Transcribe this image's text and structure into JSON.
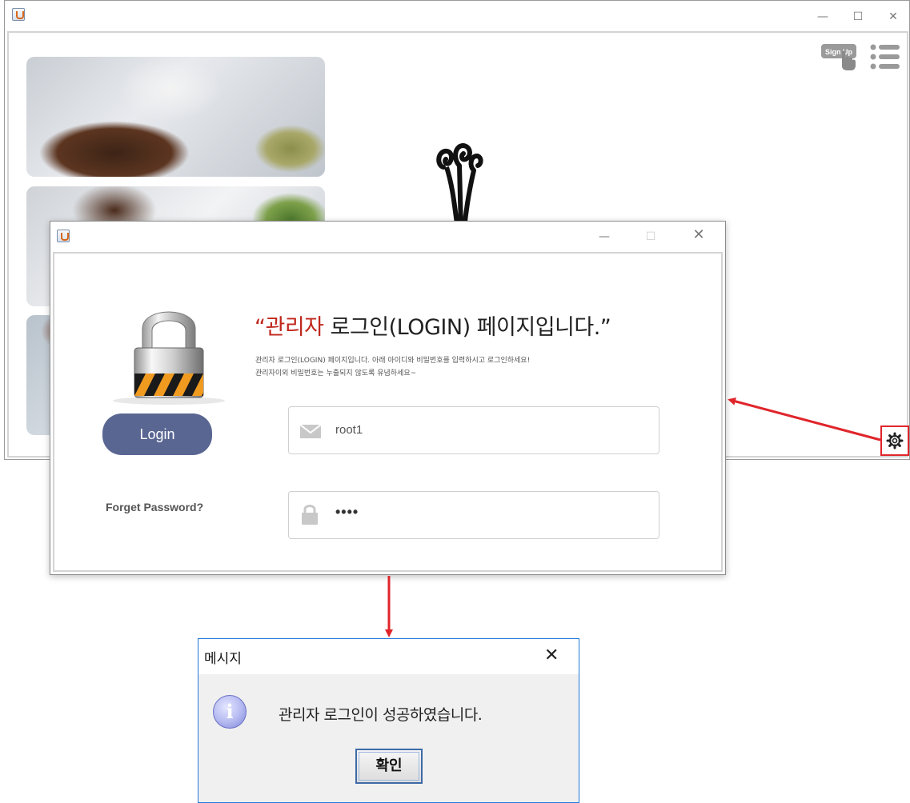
{
  "main_window": {
    "controls": {
      "minimize": "—",
      "maximize": "☐",
      "close": "✕"
    },
    "header_icons": {
      "signup": "Sign Up",
      "signup_icon": "signup-hand-icon",
      "menu_icon": "hamburger-menu-icon"
    },
    "settings_icon": "gear-icon"
  },
  "login_dialog": {
    "controls": {
      "minimize": "—",
      "maximize": "☐",
      "close": "✕"
    },
    "heading_red": "“관리자",
    "heading_rest": " 로그인(LOGIN) 페이지입니다.”",
    "subtext_line1": "관리자 로그인(LOGIN) 페이지입니다. 아래 아이디와 비밀번호를 입력하시고 로그인하세요!",
    "subtext_line2": "관리자이외 비밀번호는 누출되지 않도록 유념하세요~",
    "login_button": "Login",
    "forget_password": "Forget Password?",
    "id_value": "root1",
    "password_value": "••••",
    "colors": {
      "accent_red": "#c0271c",
      "login_button": "#5a6692"
    }
  },
  "message_dialog": {
    "title": "메시지",
    "close": "✕",
    "info_icon": "i",
    "message": "관리자 로그인이 성공하였습니다.",
    "ok_button": "확인"
  },
  "annotation": {
    "highlight_color": "#e0252b"
  }
}
